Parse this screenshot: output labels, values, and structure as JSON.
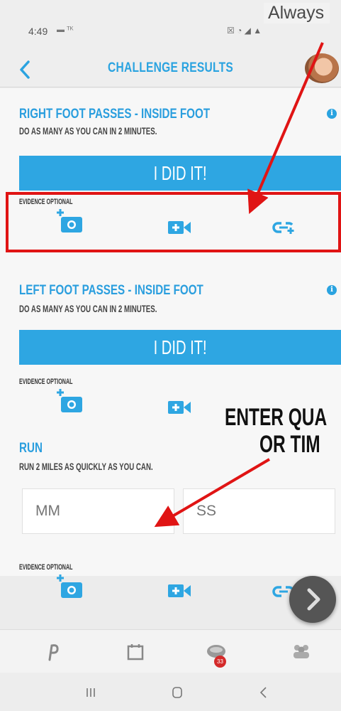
{
  "status_bar": {
    "time": "4:49",
    "left_icons": "▬ ᵀᴷ",
    "right_icons": "☒ ◔ ◢ ▲"
  },
  "header": {
    "title": "CHALLENGE RESULTS",
    "back_icon": "chevron-left-icon"
  },
  "challenges": [
    {
      "title": "RIGHT FOOT PASSES - INSIDE FOOT",
      "description": "DO AS MANY AS YOU CAN IN 2 MINUTES.",
      "button_label": "I DID IT!",
      "evidence_label": "EVIDENCE OPTIONAL"
    },
    {
      "title": "LEFT FOOT PASSES - INSIDE FOOT",
      "description": "DO AS MANY AS YOU CAN IN 2 MINUTES.",
      "button_label": "I DID IT!",
      "evidence_label": "EVIDENCE OPTIONAL"
    },
    {
      "title": "RUN",
      "description": "RUN 2 MILES AS QUICKLY AS YOU CAN.",
      "minutes_placeholder": "MM",
      "seconds_placeholder": "SS",
      "evidence_label": "EVIDENCE OPTIONAL"
    }
  ],
  "bottom_nav": {
    "badge_count": "33"
  },
  "annotations": {
    "always_text": "Always",
    "enter_line1": "ENTER QUA",
    "enter_line2": "OR TIM"
  },
  "colors": {
    "accent": "#2ea6e2",
    "annotation_red": "#e01414"
  }
}
